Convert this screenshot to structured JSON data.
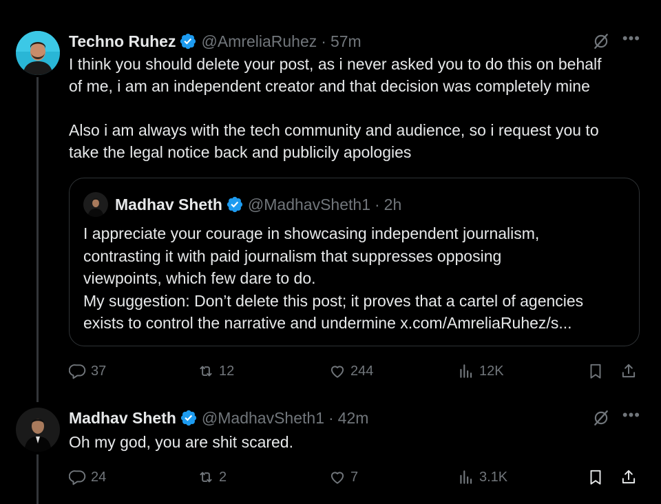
{
  "colors": {
    "background": "#000000",
    "text": "#e7e9ea",
    "muted": "#71767b",
    "verified": "#1d9bf0",
    "border": "#2f3336"
  },
  "tweet1": {
    "name": "Techno Ruhez",
    "handle": "@AmreliaRuhez",
    "separator": "·",
    "time": "57m",
    "text": "I think you should delete your post, as i never asked you to do this on behalf\nof me, i am an independent creator and that decision was completely mine\n\nAlso i am always with the tech community and audience, so i request you to\ntake the legal notice back and publicily apologies",
    "quote": {
      "name": "Madhav Sheth",
      "handle": "@MadhavSheth1",
      "separator": "·",
      "time": "2h",
      "text": "I appreciate your courage in showcasing independent journalism,\ncontrasting it with paid journalism that suppresses opposing\nviewpoints, which few dare to do.\nMy suggestion: Don’t delete this post; it proves that a cartel of agencies\nexists to control the narrative and undermine x.com/AmreliaRuhez/s..."
    },
    "stats": {
      "replies": "37",
      "reposts": "12",
      "likes": "244",
      "views": "12K"
    }
  },
  "tweet2": {
    "name": "Madhav Sheth",
    "handle": "@MadhavSheth1",
    "separator": "·",
    "time": "42m",
    "text": "Oh my god, you are shit scared.",
    "stats": {
      "replies": "24",
      "reposts": "2",
      "likes": "7",
      "views": "3.1K"
    }
  },
  "icons": [
    "verified-badge-icon",
    "grok-icon",
    "more-icon",
    "reply-icon",
    "repost-icon",
    "like-icon",
    "views-icon",
    "bookmark-icon",
    "share-icon"
  ]
}
